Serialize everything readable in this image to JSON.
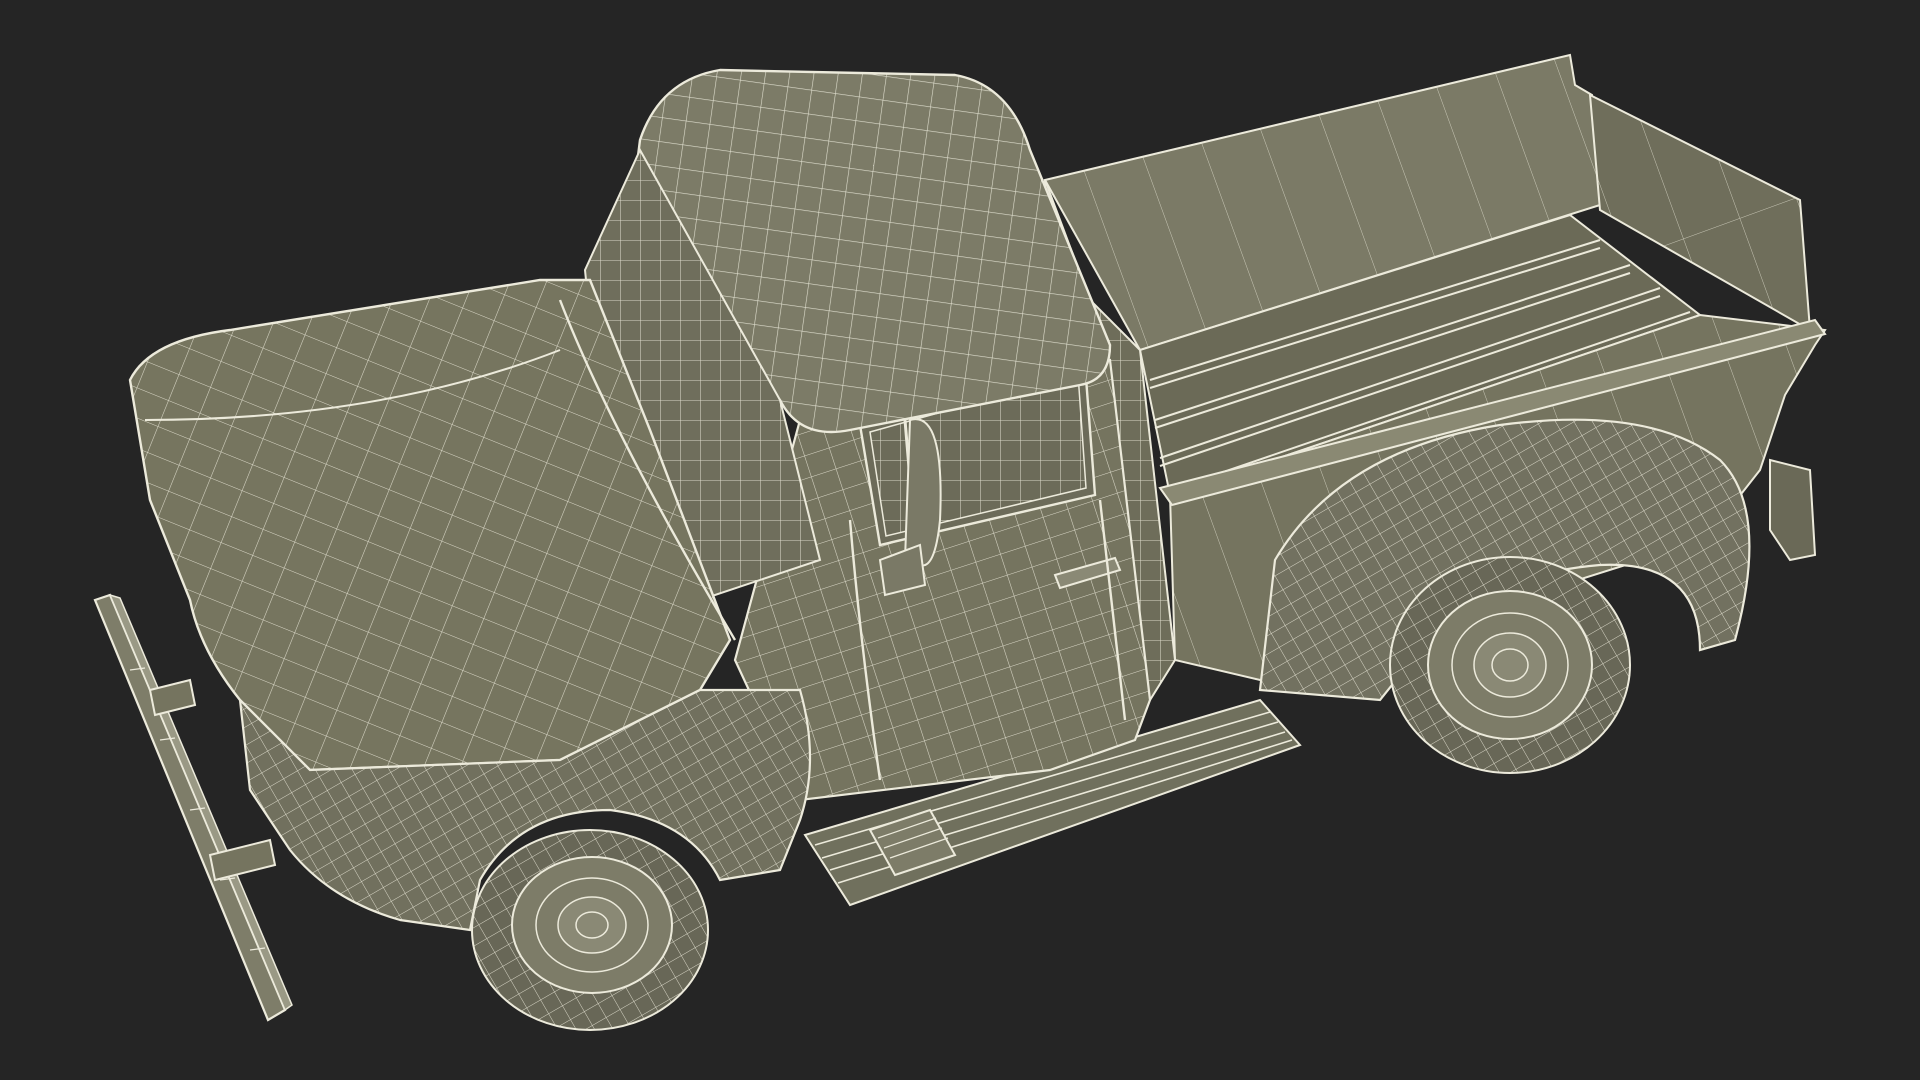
{
  "scene": {
    "background_color": "#252525",
    "model": {
      "subject": "vintage-pickup-truck",
      "render_style": "wireframe",
      "surface_color": "#75745f",
      "surface_dark_color": "#5d5c4b",
      "wire_color": "#eceadb",
      "tire_color": "#686757"
    }
  }
}
